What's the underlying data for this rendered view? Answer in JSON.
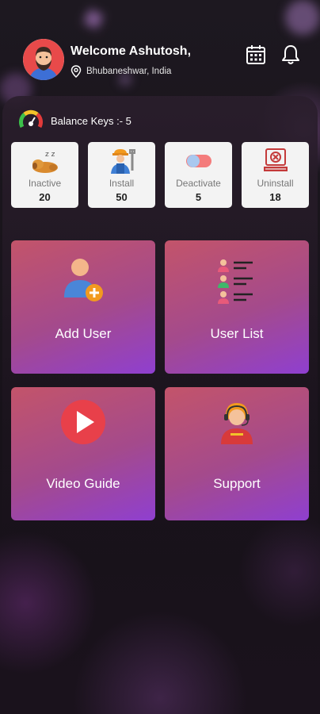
{
  "header": {
    "welcome": "Welcome Ashutosh,",
    "location": "Bhubaneshwar, India",
    "icons": [
      "calendar-icon",
      "bell-icon",
      "location-pin-icon"
    ]
  },
  "balance": {
    "label": "Balance Keys :- 5"
  },
  "stats": [
    {
      "label": "Inactive",
      "value": "20",
      "icon": "sleeping-dog-icon"
    },
    {
      "label": "Install",
      "value": "50",
      "icon": "worker-icon"
    },
    {
      "label": "Deactivate",
      "value": "5",
      "icon": "toggle-off-icon"
    },
    {
      "label": "Uninstall",
      "value": "18",
      "icon": "uninstall-icon"
    }
  ],
  "tiles": [
    {
      "label": "Add User",
      "icon": "add-user-icon"
    },
    {
      "label": "User List",
      "icon": "user-list-icon"
    },
    {
      "label": "Video Guide",
      "icon": "play-icon"
    },
    {
      "label": "Support",
      "icon": "support-agent-icon"
    }
  ],
  "colors": {
    "tile_gradient_start": "#c3546a",
    "tile_gradient_end": "#8f3fd0",
    "background": "#140f16",
    "stat_card": "#f3f3f3"
  }
}
